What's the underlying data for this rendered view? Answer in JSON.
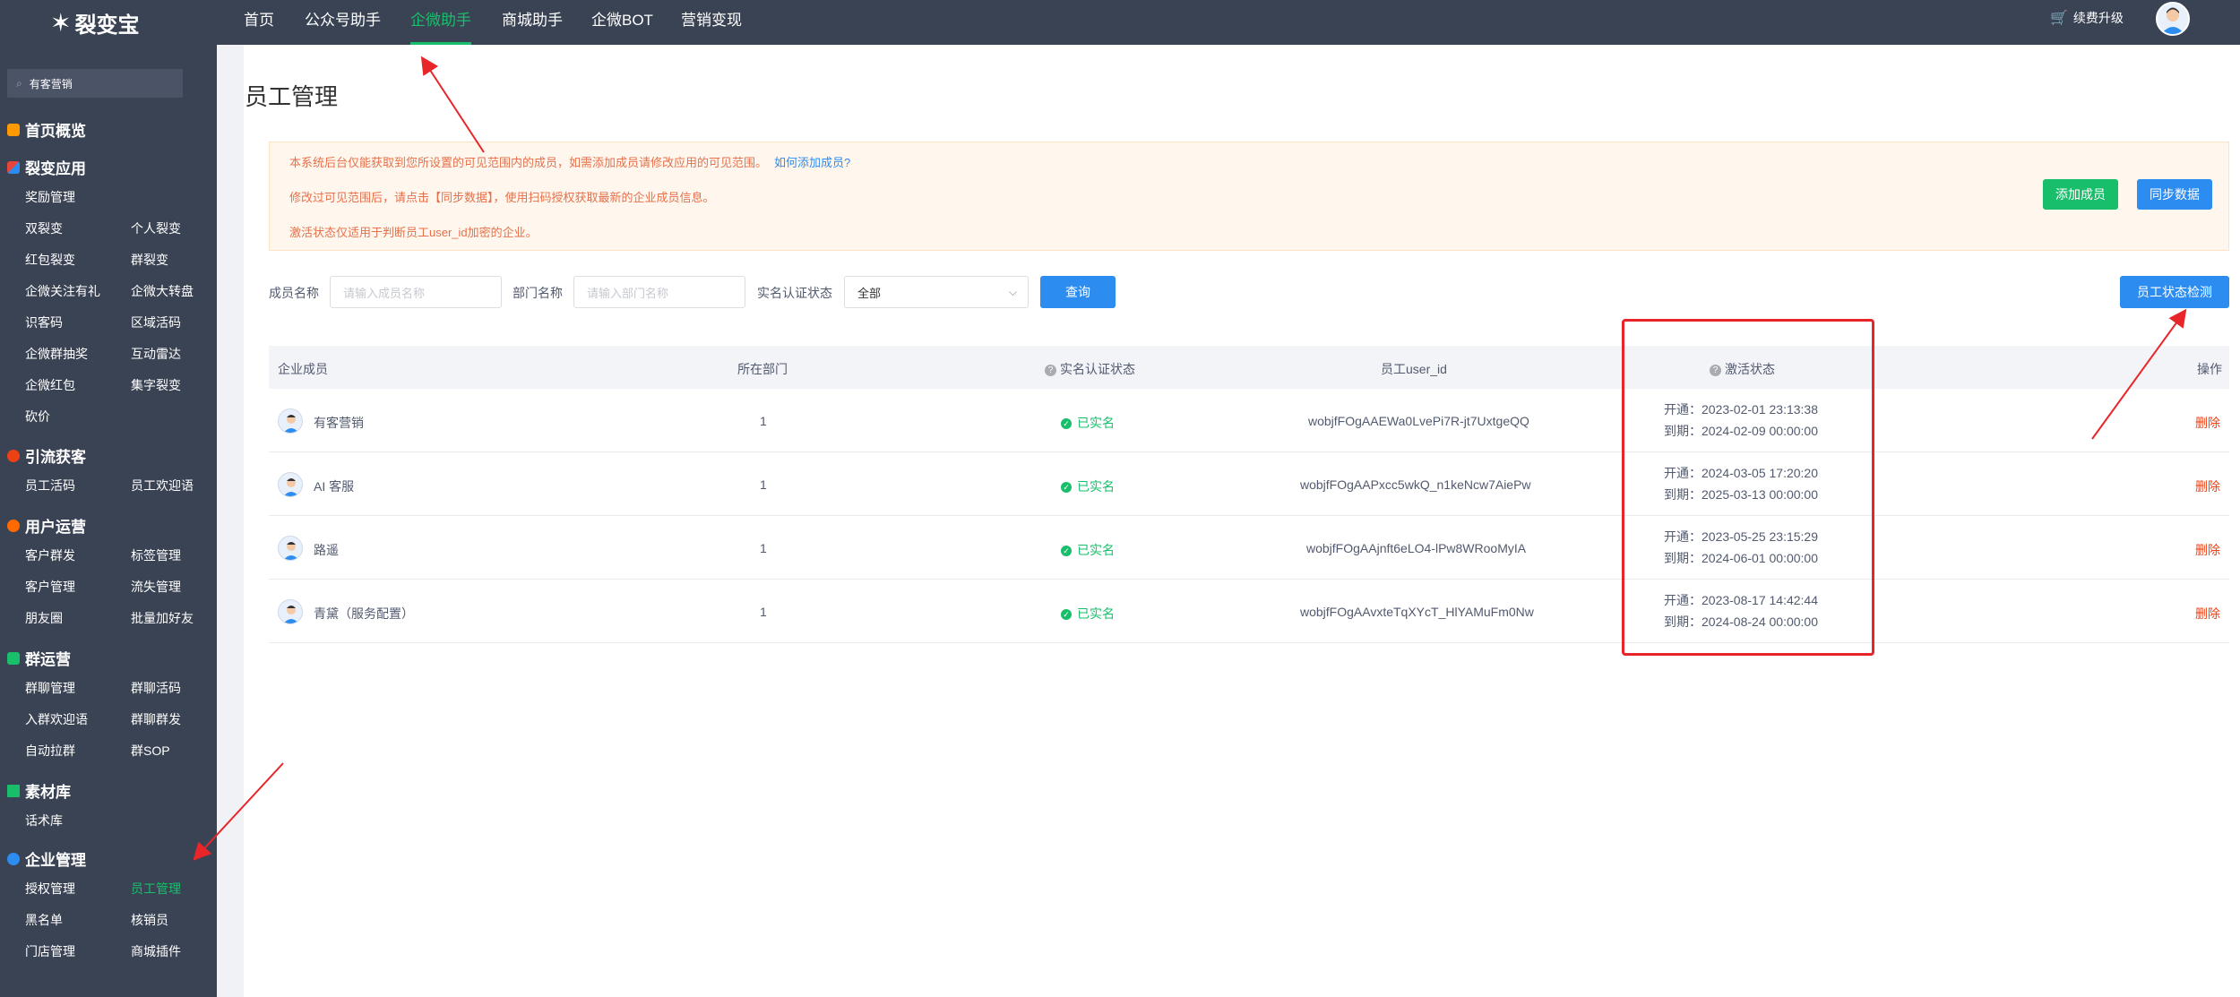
{
  "header": {
    "logo_text": "裂变宝",
    "nav": [
      "首页",
      "公众号助手",
      "企微助手",
      "商城助手",
      "企微BOT",
      "营销变现"
    ],
    "active_nav": "企微助手",
    "upgrade_label": "续费升级"
  },
  "sidebar": {
    "search_label": "有客营销",
    "groups": [
      {
        "title": "首页概览",
        "icon_color": "#ff9900",
        "items": []
      },
      {
        "title": "裂变应用",
        "icon_color": "#e8443a",
        "items": [
          "奖励管理",
          "双裂变",
          "个人裂变",
          "红包裂变",
          "群裂变",
          "企微关注有礼",
          "企微大转盘",
          "识客码",
          "区域活码",
          "企微群抽奖",
          "互动雷达",
          "企微红包",
          "集字裂变",
          "砍价"
        ]
      },
      {
        "title": "引流获客",
        "icon_color": "#ed4014",
        "items": [
          "员工活码",
          "员工欢迎语"
        ]
      },
      {
        "title": "用户运营",
        "icon_color": "#ff6a00",
        "items": [
          "客户群发",
          "标签管理",
          "客户管理",
          "流失管理",
          "朋友圈",
          "批量加好友"
        ]
      },
      {
        "title": "群运营",
        "icon_color": "#19be6b",
        "items": [
          "群聊管理",
          "群聊活码",
          "入群欢迎语",
          "群聊群发",
          "自动拉群",
          "群SOP"
        ]
      },
      {
        "title": "素材库",
        "icon_color": "#19be6b",
        "items": [
          "话术库"
        ]
      },
      {
        "title": "企业管理",
        "icon_color": "#2d8cf0",
        "items": [
          "授权管理",
          "员工管理",
          "黑名单",
          "核销员",
          "门店管理",
          "商城插件"
        ]
      }
    ],
    "active_item": "员工管理"
  },
  "page": {
    "title": "员工管理",
    "notice": {
      "line1": "本系统后台仅能获取到您所设置的可见范围内的成员，如需添加成员请修改应用的可见范围。",
      "line1_link": "如何添加成员?",
      "line2": "修改过可见范围后，请点击【同步数据】，使用扫码授权获取最新的企业成员信息。",
      "line3": "激活状态仅适用于判断员工user_id加密的企业。"
    },
    "buttons": {
      "add_member": "添加成员",
      "sync_data": "同步数据",
      "query": "查询",
      "status_check": "员工状态检测"
    },
    "filters": {
      "member_label": "成员名称",
      "member_placeholder": "请输入成员名称",
      "dept_label": "部门名称",
      "dept_placeholder": "请输入部门名称",
      "verify_label": "实名认证状态",
      "verify_value": "全部"
    },
    "table": {
      "headers": [
        "企业成员",
        "所在部门",
        "实名认证状态",
        "员工user_id",
        "激活状态",
        "操作"
      ],
      "rows": [
        {
          "name": "有客营销",
          "dept": "1",
          "verify": "已实名",
          "user_id": "wobjfFOgAAEWa0LvePi7R-jt7UxtgeQQ",
          "open": "开通：2023-02-01 23:13:38",
          "expire": "到期：2024-02-09 00:00:00",
          "action": "删除"
        },
        {
          "name": "AI 客服",
          "dept": "1",
          "verify": "已实名",
          "user_id": "wobjfFOgAAPxcc5wkQ_n1keNcw7AiePw",
          "open": "开通：2024-03-05 17:20:20",
          "expire": "到期：2025-03-13 00:00:00",
          "action": "删除"
        },
        {
          "name": "路遥",
          "dept": "1",
          "verify": "已实名",
          "user_id": "wobjfFOgAAjnft6eLO4-lPw8WRooMyIA",
          "open": "开通：2023-05-25 23:15:29",
          "expire": "到期：2024-06-01 00:00:00",
          "action": "删除"
        },
        {
          "name": "青黛（服务配置）",
          "dept": "1",
          "verify": "已实名",
          "user_id": "wobjfFOgAAvxteTqXYcT_HlYAMuFm0Nw",
          "open": "开通：2023-08-17 14:42:44",
          "expire": "到期：2024-08-24 00:00:00",
          "action": "删除"
        }
      ]
    }
  }
}
